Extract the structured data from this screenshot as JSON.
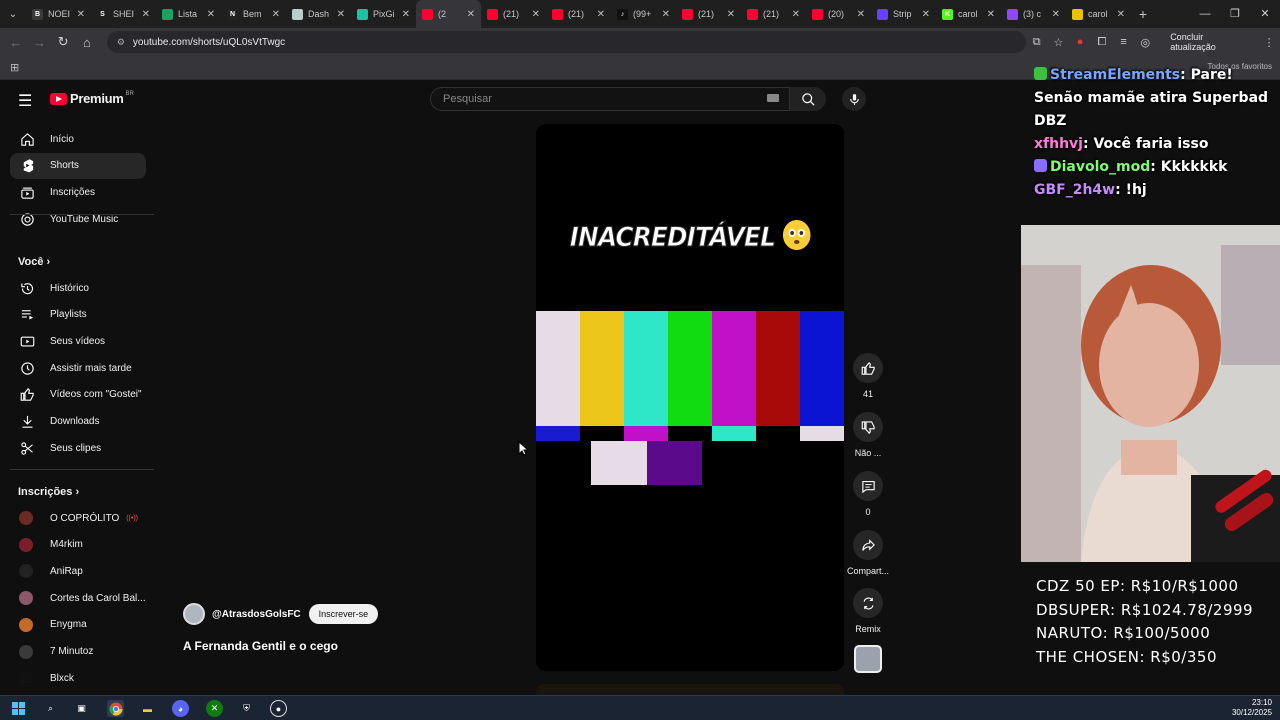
{
  "browser": {
    "tabs": [
      {
        "label": "NOEI",
        "color": "#3a3a3a",
        "glyph": "B"
      },
      {
        "label": "SHEI",
        "color": "#1f1f1f",
        "glyph": "S"
      },
      {
        "label": "Lista",
        "color": "#1aa260",
        "glyph": ""
      },
      {
        "label": "Bem",
        "color": "#222",
        "glyph": "N"
      },
      {
        "label": "Dash",
        "color": "#bcc",
        "glyph": ""
      },
      {
        "label": "PixGi",
        "color": "#20c0a0",
        "glyph": ""
      },
      {
        "label": "(2",
        "color": "#ff0033",
        "glyph": ""
      },
      {
        "label": "(21)",
        "color": "#ff0033",
        "glyph": ""
      },
      {
        "label": "(21)",
        "color": "#ff0033",
        "glyph": ""
      },
      {
        "label": "(99+",
        "color": "#111",
        "glyph": "♪"
      },
      {
        "label": "(21)",
        "color": "#ff0033",
        "glyph": ""
      },
      {
        "label": "(21)",
        "color": "#ff0033",
        "glyph": ""
      },
      {
        "label": "(20)",
        "color": "#ff0033",
        "glyph": ""
      },
      {
        "label": "Strip",
        "color": "#6441ff",
        "glyph": ""
      },
      {
        "label": "carol",
        "color": "#53fc18",
        "glyph": "K"
      },
      {
        "label": "(3) c",
        "color": "#9146ff",
        "glyph": ""
      },
      {
        "label": "carol",
        "color": "#e6c200",
        "glyph": ""
      }
    ],
    "url": "youtube.com/shorts/uQL0sVtTwgc",
    "update_label": "Concluir atualização",
    "all_favorites": "Todos os favoritos"
  },
  "youtube": {
    "logo_text": "Premium",
    "country": "BR",
    "search_placeholder": "Pesquisar"
  },
  "sidebar": {
    "main": [
      {
        "label": "Início",
        "icon": "home-icon"
      },
      {
        "label": "Shorts",
        "icon": "shorts-icon"
      },
      {
        "label": "Inscrições",
        "icon": "subscriptions-icon"
      },
      {
        "label": "YouTube Music",
        "icon": "music-icon"
      }
    ],
    "you_heading": "Você",
    "you": [
      {
        "label": "Histórico",
        "icon": "history-icon"
      },
      {
        "label": "Playlists",
        "icon": "playlists-icon"
      },
      {
        "label": "Seus vídeos",
        "icon": "your-videos-icon"
      },
      {
        "label": "Assistir mais tarde",
        "icon": "watch-later-icon"
      },
      {
        "label": "Vídeos com \"Gostei\"",
        "icon": "like-icon"
      },
      {
        "label": "Downloads",
        "icon": "download-icon"
      },
      {
        "label": "Seus clipes",
        "icon": "scissors-icon"
      }
    ],
    "subs_heading": "Inscrições",
    "subscriptions": [
      {
        "label": "O COPRÓLITO",
        "color": "#6b2a22",
        "live": true
      },
      {
        "label": "M4rkim",
        "color": "#7a1f2a",
        "live": false
      },
      {
        "label": "AniRap",
        "color": "#222",
        "live": false
      },
      {
        "label": "Cortes da Carol Bal...",
        "color": "#8a5a6a",
        "live": false
      },
      {
        "label": "Enygma",
        "color": "#c26a28",
        "live": false
      },
      {
        "label": "7 Minutoz",
        "color": "#3a3a3a",
        "live": false
      },
      {
        "label": "Blxck",
        "color": "#111",
        "live": false
      }
    ]
  },
  "short": {
    "overlay_text": "INACREDITÁVEL",
    "channel": "@AtrasdosGolsFC",
    "subscribe_label": "Inscrever-se",
    "title": "A Fernanda Gentil e o cego",
    "likes": "41",
    "dislike_label": "Não ...",
    "comments": "0",
    "share_label": "Compart...",
    "remix_label": "Remix"
  },
  "stream": {
    "chat": [
      {
        "user": "StreamElements",
        "color": "#7aa6ff",
        "badge": "#3fbf3f",
        "msg": ": Pare! Senão mamãe atira Superbad DBZ"
      },
      {
        "user": "xfhhvj",
        "color": "#ff7ad9",
        "badge": "",
        "msg": ": Você faria isso"
      },
      {
        "user": "Diavolo_mod",
        "color": "#7dff6e",
        "badge": "#8a6cff",
        "msg": ": Kkkkkkk"
      },
      {
        "user": "GBF_2h4w",
        "color": "#c58cff",
        "badge": "",
        "msg": ": !hj"
      }
    ],
    "goals": [
      "CDZ 50 EP: R$10/R$1000",
      "DBSUPER: R$1024.78/2999",
      "NARUTO: R$100/5000",
      "THE CHOSEN: R$0/350"
    ]
  },
  "taskbar": {
    "time": "23:10",
    "date": "30/12/2025"
  }
}
